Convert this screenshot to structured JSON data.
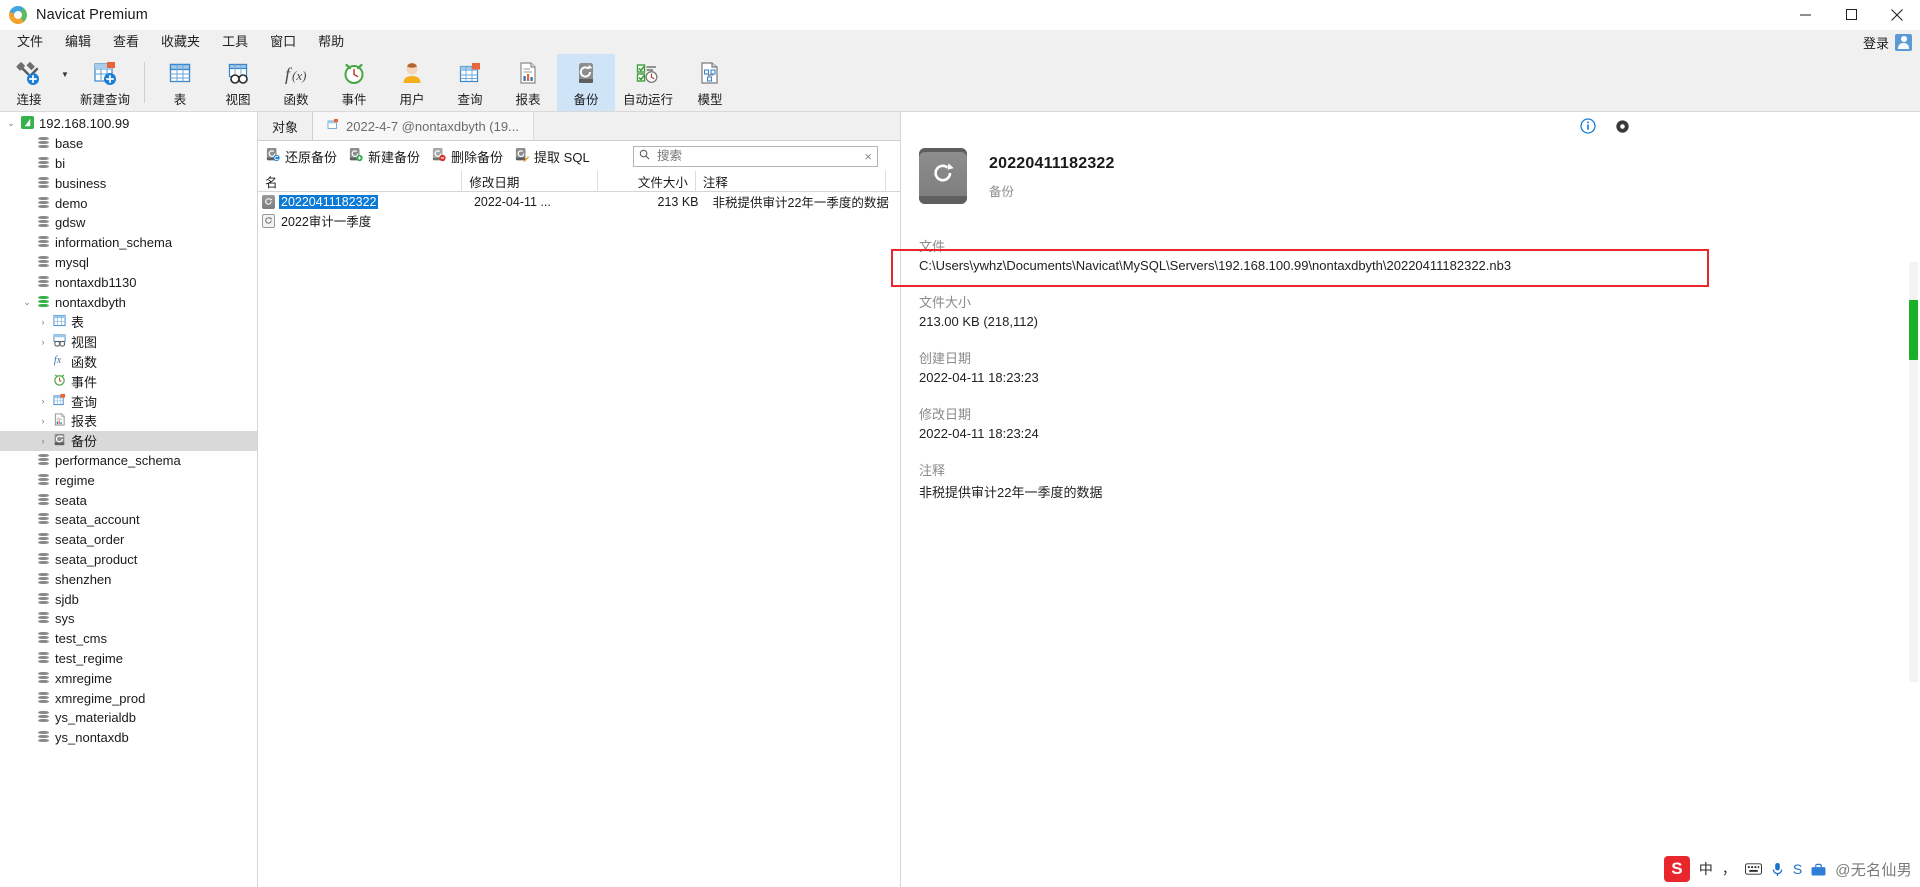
{
  "window": {
    "app_title": "Navicat Premium",
    "logo_icon": "navicat-logo-icon",
    "minimize_label": "最小化",
    "maximize_label": "最大化",
    "close_label": "关闭"
  },
  "menubar": {
    "items": [
      {
        "label": "文件",
        "name": "menu-file"
      },
      {
        "label": "编辑",
        "name": "menu-edit"
      },
      {
        "label": "查看",
        "name": "menu-view"
      },
      {
        "label": "收藏夹",
        "name": "menu-favorites"
      },
      {
        "label": "工具",
        "name": "menu-tools"
      },
      {
        "label": "窗口",
        "name": "menu-window"
      },
      {
        "label": "帮助",
        "name": "menu-help"
      }
    ],
    "login_label": "登录",
    "avatar_icon": "user-avatar-icon"
  },
  "toolbar": {
    "group1": [
      {
        "label": "连接",
        "icon": "connection-plug-icon",
        "name": "toolbar-connection"
      },
      {
        "label": "新建查询",
        "icon": "new-query-icon",
        "name": "toolbar-new-query"
      }
    ],
    "group2": [
      {
        "label": "表",
        "icon": "table-grid-icon",
        "name": "toolbar-table",
        "active": false
      },
      {
        "label": "视图",
        "icon": "view-glasses-icon",
        "name": "toolbar-view",
        "active": false
      },
      {
        "label": "函数",
        "icon": "function-fx-icon",
        "name": "toolbar-function",
        "active": false
      },
      {
        "label": "事件",
        "icon": "event-clock-icon",
        "name": "toolbar-event",
        "active": false
      },
      {
        "label": "用户",
        "icon": "user-person-icon",
        "name": "toolbar-user",
        "active": false
      },
      {
        "label": "查询",
        "icon": "query-grid-icon",
        "name": "toolbar-query",
        "active": false
      },
      {
        "label": "报表",
        "icon": "report-document-icon",
        "name": "toolbar-report",
        "active": false
      },
      {
        "label": "备份",
        "icon": "backup-restore-icon",
        "name": "toolbar-backup",
        "active": true
      },
      {
        "label": "自动运行",
        "icon": "automation-checklist-icon",
        "name": "toolbar-automation",
        "active": false
      },
      {
        "label": "模型",
        "icon": "model-diagram-icon",
        "name": "toolbar-model",
        "active": false
      }
    ]
  },
  "sidebar": {
    "nodes": [
      {
        "label": "192.168.100.99",
        "indent": 0,
        "twisty": "down",
        "icon": "navicat-connection-icon",
        "selected": false
      },
      {
        "label": "base",
        "indent": 1,
        "twisty": "",
        "icon": "database-icon",
        "selected": false
      },
      {
        "label": "bi",
        "indent": 1,
        "twisty": "",
        "icon": "database-icon",
        "selected": false
      },
      {
        "label": "business",
        "indent": 1,
        "twisty": "",
        "icon": "database-icon",
        "selected": false
      },
      {
        "label": "demo",
        "indent": 1,
        "twisty": "",
        "icon": "database-icon",
        "selected": false
      },
      {
        "label": "gdsw",
        "indent": 1,
        "twisty": "",
        "icon": "database-icon",
        "selected": false
      },
      {
        "label": "information_schema",
        "indent": 1,
        "twisty": "",
        "icon": "database-icon",
        "selected": false
      },
      {
        "label": "mysql",
        "indent": 1,
        "twisty": "",
        "icon": "database-icon",
        "selected": false
      },
      {
        "label": "nontaxdb1130",
        "indent": 1,
        "twisty": "",
        "icon": "database-icon",
        "selected": false
      },
      {
        "label": "nontaxdbyth",
        "indent": 1,
        "twisty": "down",
        "icon": "database-icon-green",
        "selected": false
      },
      {
        "label": "表",
        "indent": 2,
        "twisty": "right",
        "icon": "table-grid-icon",
        "selected": false
      },
      {
        "label": "视图",
        "indent": 2,
        "twisty": "right",
        "icon": "view-glasses-icon",
        "selected": false
      },
      {
        "label": "函数",
        "indent": 2,
        "twisty": "",
        "icon": "function-fx-icon",
        "selected": false
      },
      {
        "label": "事件",
        "indent": 2,
        "twisty": "",
        "icon": "event-clock-icon",
        "selected": false
      },
      {
        "label": "查询",
        "indent": 2,
        "twisty": "right",
        "icon": "query-grid-icon",
        "selected": false
      },
      {
        "label": "报表",
        "indent": 2,
        "twisty": "right",
        "icon": "report-document-icon",
        "selected": false
      },
      {
        "label": "备份",
        "indent": 2,
        "twisty": "right",
        "icon": "backup-restore-icon",
        "selected": true
      },
      {
        "label": "performance_schema",
        "indent": 1,
        "twisty": "",
        "icon": "database-icon",
        "selected": false
      },
      {
        "label": "regime",
        "indent": 1,
        "twisty": "",
        "icon": "database-icon",
        "selected": false
      },
      {
        "label": "seata",
        "indent": 1,
        "twisty": "",
        "icon": "database-icon",
        "selected": false
      },
      {
        "label": "seata_account",
        "indent": 1,
        "twisty": "",
        "icon": "database-icon",
        "selected": false
      },
      {
        "label": "seata_order",
        "indent": 1,
        "twisty": "",
        "icon": "database-icon",
        "selected": false
      },
      {
        "label": "seata_product",
        "indent": 1,
        "twisty": "",
        "icon": "database-icon",
        "selected": false
      },
      {
        "label": "shenzhen",
        "indent": 1,
        "twisty": "",
        "icon": "database-icon",
        "selected": false
      },
      {
        "label": "sjdb",
        "indent": 1,
        "twisty": "",
        "icon": "database-icon",
        "selected": false
      },
      {
        "label": "sys",
        "indent": 1,
        "twisty": "",
        "icon": "database-icon",
        "selected": false
      },
      {
        "label": "test_cms",
        "indent": 1,
        "twisty": "",
        "icon": "database-icon",
        "selected": false
      },
      {
        "label": "test_regime",
        "indent": 1,
        "twisty": "",
        "icon": "database-icon",
        "selected": false
      },
      {
        "label": "xmregime",
        "indent": 1,
        "twisty": "",
        "icon": "database-icon",
        "selected": false
      },
      {
        "label": "xmregime_prod",
        "indent": 1,
        "twisty": "",
        "icon": "database-icon",
        "selected": false
      },
      {
        "label": "ys_materialdb",
        "indent": 1,
        "twisty": "",
        "icon": "database-icon",
        "selected": false
      },
      {
        "label": "ys_nontaxdb",
        "indent": 1,
        "twisty": "",
        "icon": "database-icon",
        "selected": false
      }
    ]
  },
  "tabs": {
    "object_tab": "对象",
    "doc_tab": "2022-4-7 @nontaxdbyth (19...",
    "doc_tab_icon": "query-grid-icon"
  },
  "actions": [
    {
      "label": "还原备份",
      "icon": "restore-backup-icon",
      "name": "restore-backup-button"
    },
    {
      "label": "新建备份",
      "icon": "new-backup-icon",
      "name": "new-backup-button"
    },
    {
      "label": "删除备份",
      "icon": "delete-backup-icon",
      "name": "delete-backup-button"
    },
    {
      "label": "提取 SQL",
      "icon": "extract-sql-icon",
      "name": "extract-sql-button"
    }
  ],
  "search": {
    "placeholder": "搜索",
    "value": "",
    "icon": "search-icon",
    "clear_icon": "clear-icon"
  },
  "list": {
    "columns": [
      {
        "label": "名",
        "key": "name"
      },
      {
        "label": "修改日期",
        "key": "modified"
      },
      {
        "label": "文件大小",
        "key": "size"
      },
      {
        "label": "注释",
        "key": "comment"
      }
    ],
    "rows": [
      {
        "name": "20220411182322",
        "modified": "2022-04-11 ...",
        "size": "213 KB",
        "comment": "非税提供审计22年一季度的数据",
        "selected": true,
        "icon": "backup-restore-icon"
      },
      {
        "name": "2022审计一季度",
        "modified": "",
        "size": "",
        "comment": "",
        "selected": false,
        "icon": "backup-restore-icon"
      }
    ]
  },
  "details": {
    "info_icon": "info-icon",
    "settings_icon": "gear-icon",
    "title": "20220411182322",
    "subtitle": "备份",
    "big_icon": "backup-restore-icon",
    "fields": [
      {
        "key": "文件",
        "value": "C:\\Users\\ywhz\\Documents\\Navicat\\MySQL\\Servers\\192.168.100.99\\nontaxdbyth\\20220411182322.nb3",
        "highlight": true,
        "name": "detail-file"
      },
      {
        "key": "文件大小",
        "value": "213.00 KB (218,112)",
        "highlight": false,
        "name": "detail-file-size"
      },
      {
        "key": "创建日期",
        "value": "2022-04-11 18:23:23",
        "highlight": false,
        "name": "detail-created"
      },
      {
        "key": "修改日期",
        "value": "2022-04-11 18:23:24",
        "highlight": false,
        "name": "detail-modified"
      },
      {
        "key": "注释",
        "value": "非税提供审计22年一季度的数据",
        "highlight": false,
        "name": "detail-comment"
      }
    ],
    "highlight_color": "#e8262b"
  },
  "ime": {
    "logo": "S",
    "mode": "中",
    "punctuation": "，",
    "keyboard_icon": "keyboard-icon",
    "mic_icon": "microphone-icon",
    "s_icon": "S",
    "tools_icon": "toolbox-icon",
    "watermark": "@无名仙男"
  }
}
